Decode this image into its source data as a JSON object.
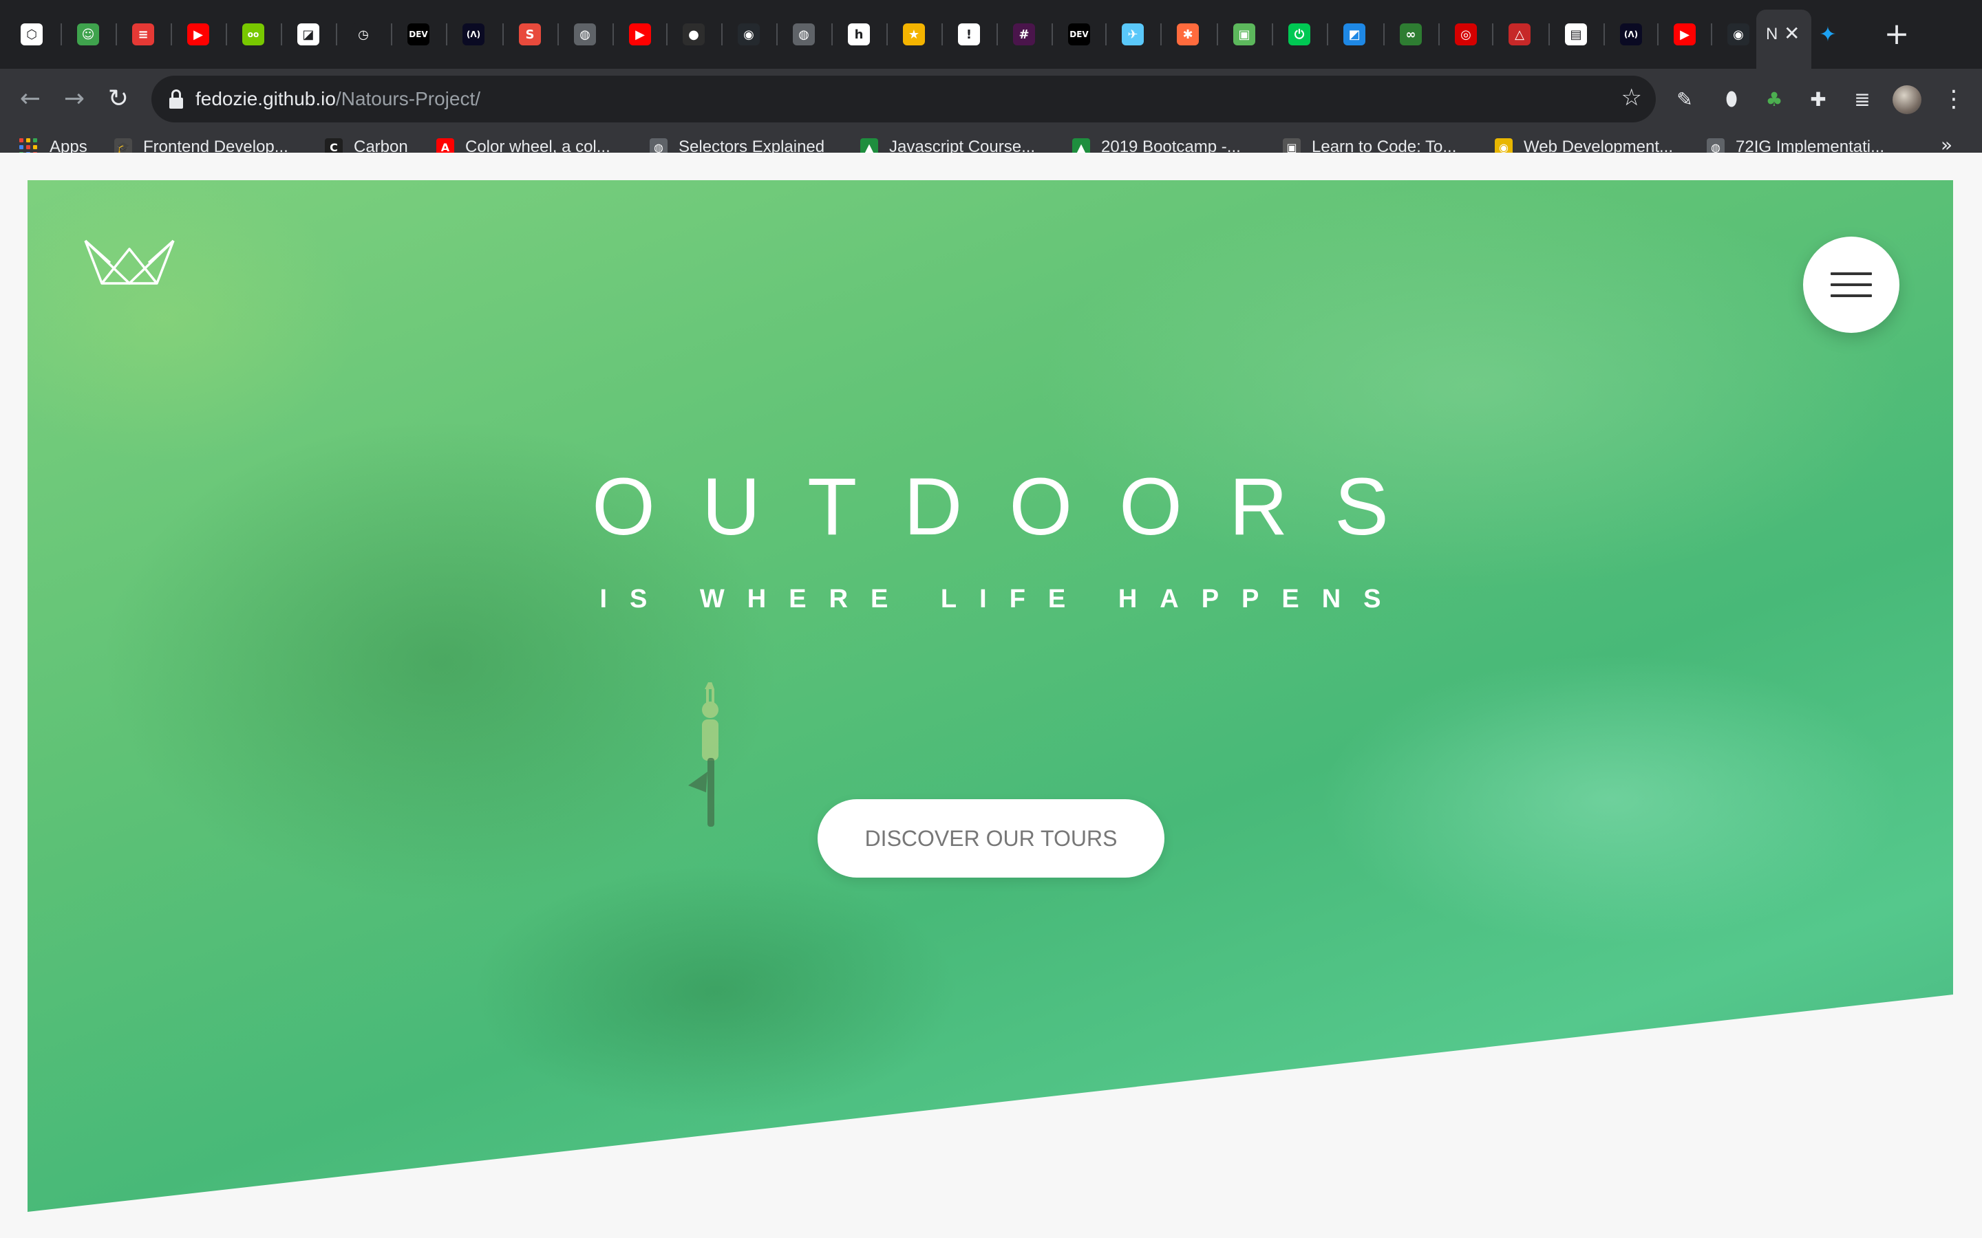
{
  "browser": {
    "tabs": [
      {
        "icon": "codesandbox-icon",
        "color": "#ffffff",
        "glyph": "⬡"
      },
      {
        "icon": "froggy-icon",
        "color": "#3fa34d",
        "glyph": "☺"
      },
      {
        "icon": "bars-icon",
        "color": "#e53935",
        "glyph": "≡"
      },
      {
        "icon": "youtube-icon",
        "color": "#ff0000",
        "glyph": "▶"
      },
      {
        "icon": "duolingo-icon",
        "color": "#78c800",
        "glyph": "oo"
      },
      {
        "icon": "codepen-icon",
        "color": "#ffffff",
        "glyph": "◪"
      },
      {
        "icon": "clock-icon",
        "color": "#202124",
        "glyph": "◷"
      },
      {
        "icon": "dev-icon",
        "color": "#000000",
        "glyph": "DEV"
      },
      {
        "icon": "freecodecamp-icon",
        "color": "#0a0a23",
        "glyph": "(Λ)"
      },
      {
        "icon": "speakerdeck-icon",
        "color": "#e84a3c",
        "glyph": "S"
      },
      {
        "icon": "globe-icon",
        "color": "#5f6368",
        "glyph": "◍"
      },
      {
        "icon": "youtube-icon",
        "color": "#ff0000",
        "glyph": "▶"
      },
      {
        "icon": "dark-circle-icon",
        "color": "#2d2d2d",
        "glyph": "●"
      },
      {
        "icon": "github-icon",
        "color": "#24292e",
        "glyph": "◉"
      },
      {
        "icon": "globe-icon",
        "color": "#5f6368",
        "glyph": "◍"
      },
      {
        "icon": "hashnode-icon",
        "color": "#ffffff",
        "glyph": "h"
      },
      {
        "icon": "star-icon",
        "color": "#f4b400",
        "glyph": "★"
      },
      {
        "icon": "alert-icon",
        "color": "#ffffff",
        "glyph": "!"
      },
      {
        "icon": "slack-icon",
        "color": "#4a154b",
        "glyph": "#"
      },
      {
        "icon": "dev-icon",
        "color": "#000000",
        "glyph": "DEV"
      },
      {
        "icon": "bird-icon",
        "color": "#5ac8fa",
        "glyph": "✈"
      },
      {
        "icon": "color-wheel-icon",
        "color": "#ff6b3d",
        "glyph": "✱"
      },
      {
        "icon": "app-icon",
        "color": "#5cb85c",
        "glyph": "▣"
      },
      {
        "icon": "power-icon",
        "color": "#00c853",
        "glyph": "⏻"
      },
      {
        "icon": "photo-icon",
        "color": "#1e88e5",
        "glyph": "◩"
      },
      {
        "icon": "infinity-icon",
        "color": "#2e7d32",
        "glyph": "∞"
      },
      {
        "icon": "badge-icon",
        "color": "#d50000",
        "glyph": "◎"
      },
      {
        "icon": "angular-icon",
        "color": "#c62828",
        "glyph": "△"
      },
      {
        "icon": "document-icon",
        "color": "#ffffff",
        "glyph": "▤"
      },
      {
        "icon": "freecodecamp-icon",
        "color": "#0a0a23",
        "glyph": "(Λ)"
      },
      {
        "icon": "youtube-icon",
        "color": "#ff0000",
        "glyph": "▶"
      },
      {
        "icon": "github-icon",
        "color": "#24292e",
        "glyph": "◉"
      }
    ],
    "active_tab": {
      "label": "N",
      "close": "✕"
    },
    "twitter_tab_glyph": "🐦",
    "new_tab": "+",
    "back": "←",
    "forward": "→",
    "reload": "↻",
    "url_host": "fedozie.github.io",
    "url_path": "/Natours-Project/",
    "bookmark_star": "☆",
    "extensions": [
      {
        "icon": "pen-icon",
        "glyph": "✎"
      },
      {
        "icon": "mouse-icon",
        "glyph": "⬮"
      },
      {
        "icon": "tree-icon",
        "glyph": "♣"
      },
      {
        "icon": "puzzle-icon",
        "glyph": "✚"
      },
      {
        "icon": "media-queue-icon",
        "glyph": "≣"
      }
    ],
    "menu_dots": "⋮",
    "bookmarks": [
      {
        "label": "Apps",
        "icon": "apps-grid-icon"
      },
      {
        "label": "Frontend Develop...",
        "icon": "graduation-cap-icon",
        "glyph": "🎓",
        "color": "#4a4a4a"
      },
      {
        "label": "Carbon",
        "icon": "carbon-icon",
        "glyph": "C",
        "color": "#1f1f1f"
      },
      {
        "label": "Color wheel, a col...",
        "icon": "adobe-icon",
        "glyph": "A",
        "color": "#ff0000"
      },
      {
        "label": "Selectors Explained",
        "icon": "globe-icon",
        "glyph": "◍",
        "color": "#5f6368"
      },
      {
        "label": "Javascript Course...",
        "icon": "google-drive-icon",
        "glyph": "▲",
        "color": "#1e8e3e"
      },
      {
        "label": "2019 Bootcamp -...",
        "icon": "google-drive-icon",
        "glyph": "▲",
        "color": "#1e8e3e"
      },
      {
        "label": "Learn to Code: To...",
        "icon": "scrimba-icon",
        "glyph": "▣",
        "color": "#555"
      },
      {
        "label": "Web Development...",
        "icon": "udemy-icon",
        "glyph": "◉",
        "color": "#e8b600"
      },
      {
        "label": "72IG Implementati...",
        "icon": "globe-icon",
        "glyph": "◍",
        "color": "#5f6368"
      }
    ],
    "more_bookmarks": "»"
  },
  "hero": {
    "title": "OUTDOORS",
    "subtitle": "IS WHERE LIFE HAPPENS",
    "cta_label": "DISCOVER OUR TOURS"
  },
  "colors": {
    "hero_green_light": "#7ed07e",
    "hero_green_dark": "#3fae7a",
    "page_bg": "#f7f7f7",
    "chrome_dark": "#202124",
    "chrome_toolbar": "#35363a"
  }
}
